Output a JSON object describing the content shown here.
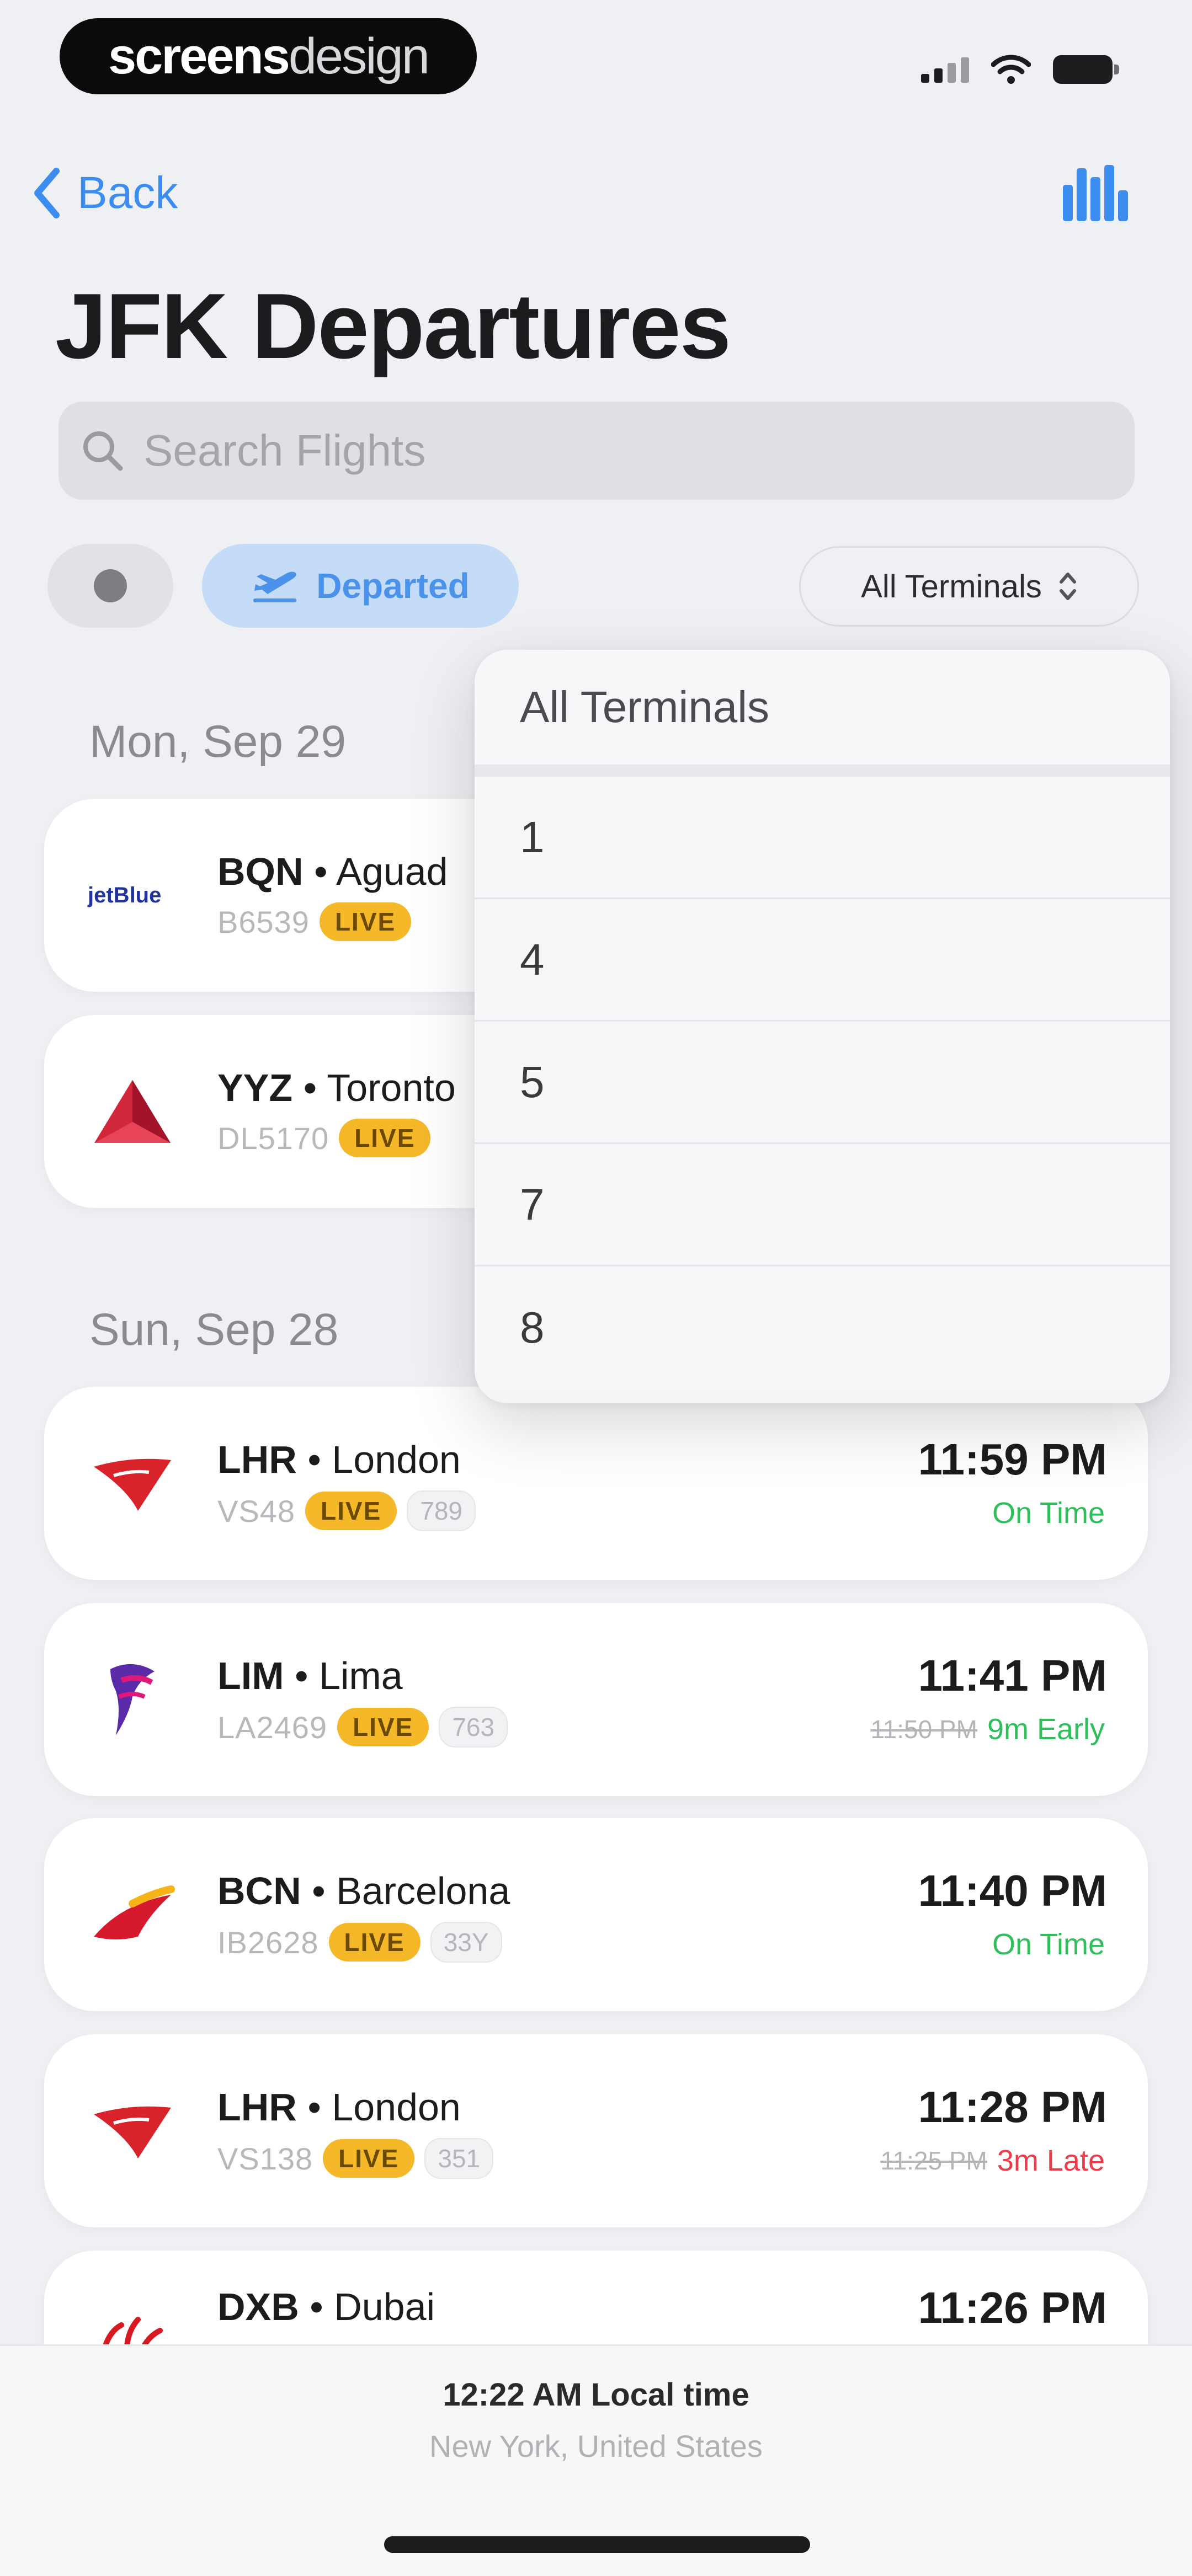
{
  "status_bar": {
    "brand_bold": "screens",
    "brand_light": "design"
  },
  "nav": {
    "back_label": "Back",
    "title": "JFK Departures"
  },
  "search": {
    "placeholder": "Search Flights",
    "value": ""
  },
  "filters": {
    "departed_label": "Departed",
    "terminal_selected": "All Terminals"
  },
  "dropdown": {
    "header": "All Terminals",
    "options": [
      "1",
      "4",
      "5",
      "7",
      "8"
    ]
  },
  "sections": [
    {
      "date": "Mon, Sep 29",
      "flights": [
        {
          "code": "BQN",
          "city": "Aguad",
          "flight_no": "B6539",
          "live": "LIVE",
          "tail": "",
          "time": "",
          "scheduled": "",
          "status": "",
          "status_type": "",
          "airline": "jetBlue"
        },
        {
          "code": "YYZ",
          "city": "Toronto",
          "flight_no": "DL5170",
          "live": "LIVE",
          "tail": "",
          "time": "",
          "scheduled": "",
          "status": "",
          "status_type": "",
          "airline": "delta"
        }
      ]
    },
    {
      "date": "Sun, Sep 28",
      "flights": [
        {
          "code": "LHR",
          "city": "London",
          "flight_no": "VS48",
          "live": "LIVE",
          "tail": "789",
          "time": "11:59 PM",
          "scheduled": "",
          "status": "On Time",
          "status_type": "ontime",
          "airline": "virgin"
        },
        {
          "code": "LIM",
          "city": "Lima",
          "flight_no": "LA2469",
          "live": "LIVE",
          "tail": "763",
          "time": "11:41 PM",
          "scheduled": "11:50 PM",
          "status": "9m Early",
          "status_type": "early",
          "airline": "latam"
        },
        {
          "code": "BCN",
          "city": "Barcelona",
          "flight_no": "IB2628",
          "live": "LIVE",
          "tail": "33Y",
          "time": "11:40 PM",
          "scheduled": "",
          "status": "On Time",
          "status_type": "ontime",
          "airline": "iberia"
        },
        {
          "code": "LHR",
          "city": "London",
          "flight_no": "VS138",
          "live": "LIVE",
          "tail": "351",
          "time": "11:28 PM",
          "scheduled": "11:25 PM",
          "status": "3m Late",
          "status_type": "late",
          "airline": "virgin"
        },
        {
          "code": "DXB",
          "city": "Dubai",
          "flight_no": "",
          "live": "",
          "tail": "",
          "time": "11:26 PM",
          "scheduled": "",
          "status": "",
          "status_type": "",
          "airline": "emirates"
        }
      ]
    }
  ],
  "footer": {
    "local_time": "12:22 AM Local time",
    "location": "New York, United States"
  },
  "colors": {
    "accent": "#3b8ef0",
    "live_badge": "#f4b829",
    "on_time": "#2fbf5a",
    "late": "#ee3b4a"
  }
}
